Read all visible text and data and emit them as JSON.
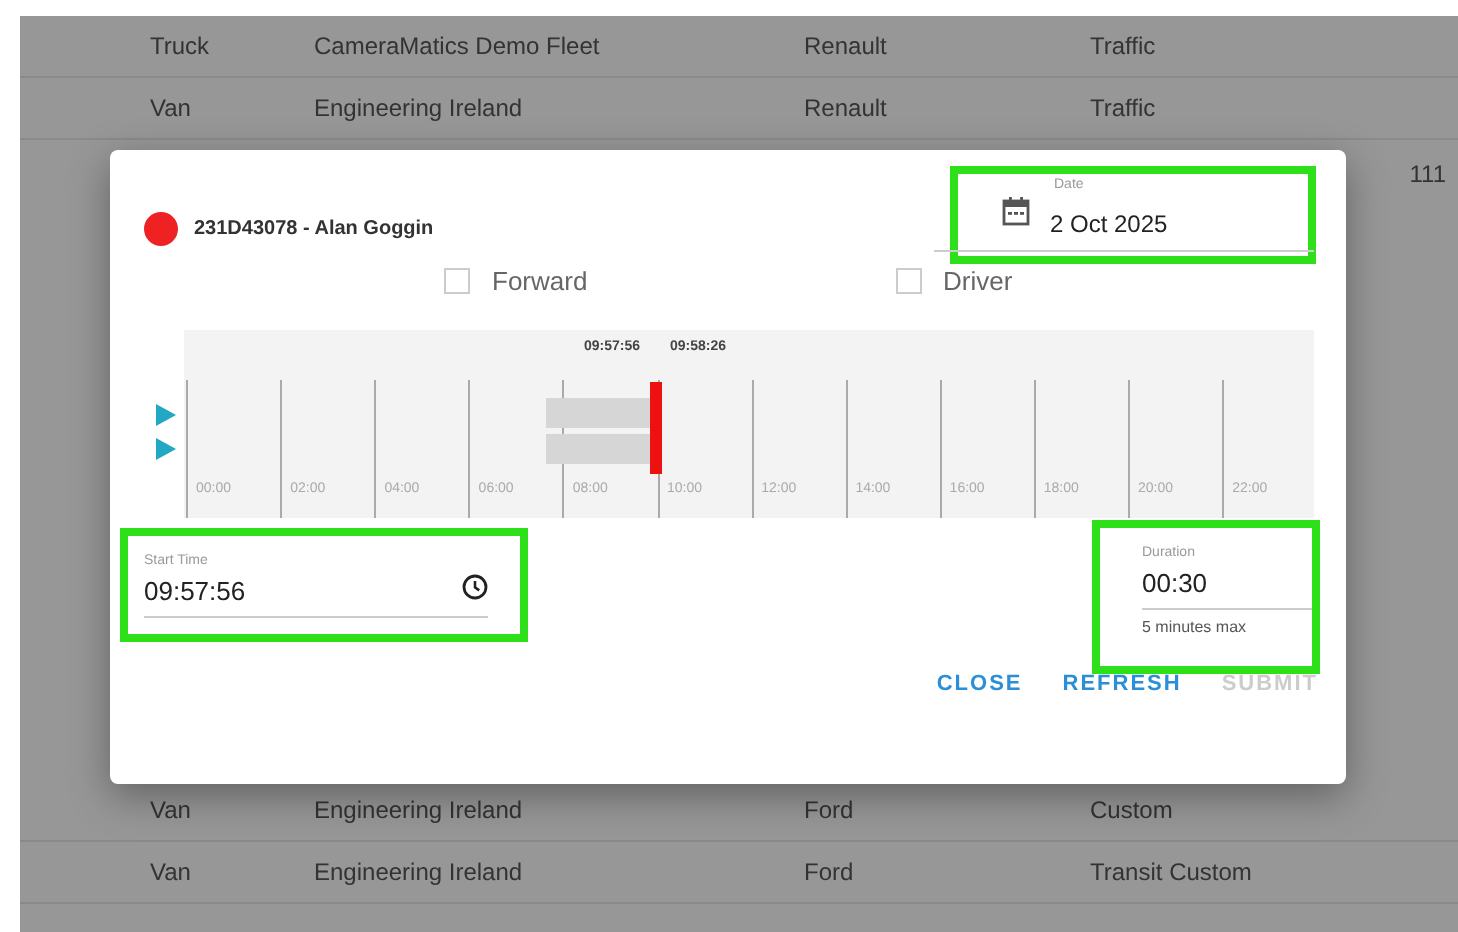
{
  "background_table": {
    "rows_above": [
      {
        "cells": [
          "Truck",
          "CameraMatics Demo Fleet",
          "Renault",
          "Traffic"
        ]
      },
      {
        "cells": [
          "Van",
          "Engineering Ireland",
          "Renault",
          "Traffic"
        ]
      }
    ],
    "side_text": "111",
    "rows_below": [
      {
        "cells": [
          "Van",
          "Engineering Ireland",
          "Ford",
          "Custom"
        ]
      },
      {
        "cells": [
          "Van",
          "Engineering Ireland",
          "Ford",
          "Transit Custom"
        ]
      }
    ]
  },
  "dialog": {
    "vehicle": {
      "label": "231D43078 - Alan Goggin",
      "color": "#ee2222"
    },
    "date": {
      "label": "Date",
      "value": "2 Oct 2025",
      "highlighted": true
    },
    "checkboxes": [
      {
        "label": "Forward",
        "checked": false
      },
      {
        "label": "Driver",
        "checked": false
      }
    ],
    "timeline": {
      "marker_labels": [
        "09:57:56",
        "09:58:26"
      ],
      "ticks": [
        "00:00",
        "02:00",
        "04:00",
        "06:00",
        "08:00",
        "10:00",
        "12:00",
        "14:00",
        "16:00",
        "18:00",
        "20:00",
        "22:00"
      ]
    },
    "start_time": {
      "label": "Start Time",
      "value": "09:57:56",
      "highlighted": true
    },
    "duration": {
      "label": "Duration",
      "value": "00:30",
      "hint": "5 minutes max",
      "highlighted": true
    },
    "buttons": [
      {
        "label": "CLOSE",
        "disabled": false
      },
      {
        "label": "REFRESH",
        "disabled": false
      },
      {
        "label": "SUBMIT",
        "disabled": true
      }
    ]
  }
}
